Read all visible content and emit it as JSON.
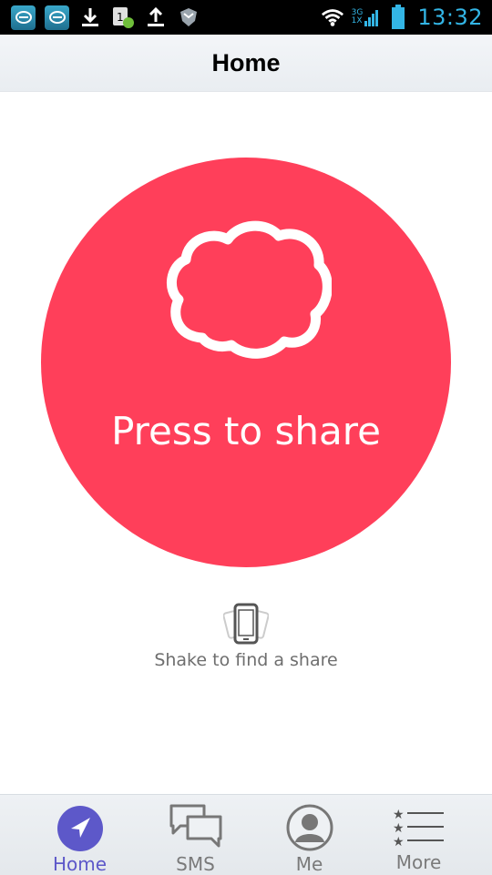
{
  "status_bar": {
    "time": "13:32",
    "network": "3G",
    "network_sub": "1X",
    "icons": [
      "app-icon",
      "app-icon",
      "download-icon",
      "sim-update-icon",
      "upload-icon",
      "shield-icon",
      "wifi-icon",
      "signal-icon",
      "battery-icon"
    ]
  },
  "header": {
    "title": "Home"
  },
  "main": {
    "share_button_label": "Press to share",
    "share_icon": "cloud-icon",
    "accent_color": "#ff3f5a",
    "shake_icon": "shake-phone-icon",
    "shake_label": "Shake to find a share"
  },
  "tabs": [
    {
      "label": "Home",
      "icon": "navigation-arrow-icon",
      "active": true
    },
    {
      "label": "SMS",
      "icon": "chat-bubbles-icon",
      "active": false
    },
    {
      "label": "Me",
      "icon": "profile-icon",
      "active": false
    },
    {
      "label": "More",
      "icon": "star-list-icon",
      "active": false
    }
  ],
  "colors": {
    "tab_active": "#5d58c9",
    "tab_inactive": "#7a7a7a",
    "time_color": "#33b5e5"
  }
}
